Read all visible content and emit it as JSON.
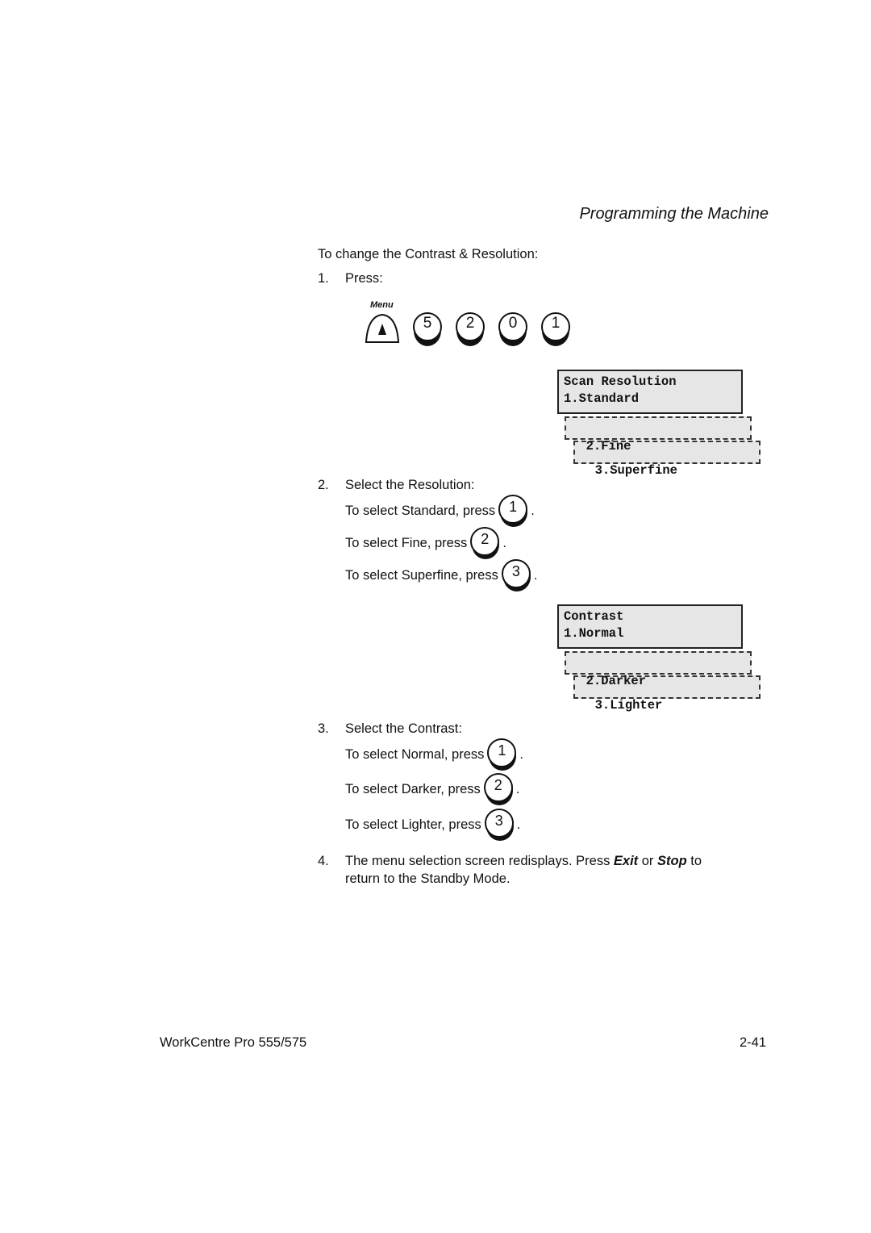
{
  "page": {
    "section_title": "Programming the Machine",
    "intro": "To change the Contrast & Resolution:",
    "step1": {
      "num": "1.",
      "text": "Press:"
    },
    "menu_key": {
      "label": "Menu",
      "icon": "up-triangle-icon"
    },
    "key_sequence": [
      "5",
      "2",
      "0",
      "1"
    ],
    "scan_resolution_display": {
      "title": "Scan Resolution",
      "options": [
        "1.Standard",
        "2.Fine",
        "3.Superfine"
      ]
    },
    "step2": {
      "num": "2.",
      "text": "Select the Resolution:",
      "items": [
        {
          "text": "To select Standard, press",
          "key": "1"
        },
        {
          "text": "To select Fine, press",
          "key": "2"
        },
        {
          "text": "To select Superfine, press",
          "key": "3"
        }
      ]
    },
    "contrast_display": {
      "title": "Contrast",
      "options": [
        "1.Normal",
        "2.Darker",
        "3.Lighter"
      ]
    },
    "step3": {
      "num": "3.",
      "text": "Select the Contrast:",
      "items": [
        {
          "text": "To select Normal, press",
          "key": "1"
        },
        {
          "text": "To select Darker, press",
          "key": "2"
        },
        {
          "text": "To select Lighter, press",
          "key": "3"
        }
      ]
    },
    "step4": {
      "num": "4.",
      "text_a": "The menu selection screen redisplays. Press ",
      "exit": "Exit",
      "or": " or ",
      "stop": "Stop",
      "text_b": " to",
      "text_c": "return to the Standby Mode."
    },
    "period": "."
  },
  "footer": {
    "product": "WorkCentre Pro 555/575",
    "page_number": "2-41"
  }
}
